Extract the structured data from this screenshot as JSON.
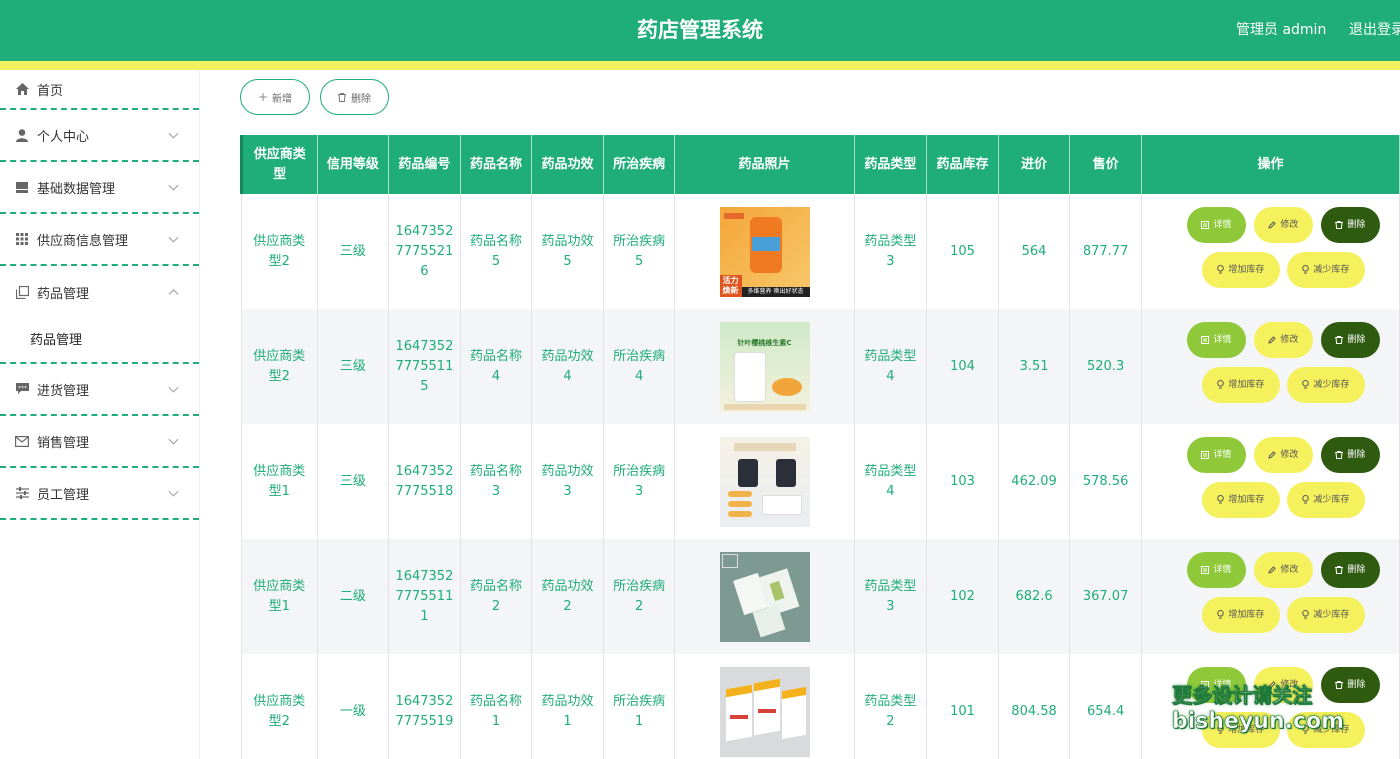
{
  "header": {
    "title": "药店管理系统",
    "admin_label": "管理员 admin",
    "logout_label": "退出登录"
  },
  "sidebar": {
    "items": [
      {
        "label": "首页",
        "icon": "home-icon"
      },
      {
        "label": "个人中心",
        "icon": "user-icon"
      },
      {
        "label": "基础数据管理",
        "icon": "database-icon"
      },
      {
        "label": "供应商信息管理",
        "icon": "grid-icon"
      },
      {
        "label": "药品管理",
        "icon": "copy-icon",
        "expanded": true
      },
      {
        "label": "进货管理",
        "icon": "chat-icon"
      },
      {
        "label": "销售管理",
        "icon": "mail-icon"
      },
      {
        "label": "员工管理",
        "icon": "sliders-icon"
      }
    ],
    "submenu": {
      "label": "药品管理"
    }
  },
  "toolbar": {
    "add_label": "新增",
    "delete_label": "删除"
  },
  "table": {
    "columns": [
      "供应商类型",
      "信用等级",
      "药品编号",
      "药品名称",
      "药品功效",
      "所治疾病",
      "药品照片",
      "药品类型",
      "药品库存",
      "进价",
      "售价",
      "操作"
    ],
    "rows": [
      {
        "supplier_type": "供应商类型2",
        "credit": "三级",
        "code": "16473527775521 6",
        "name": "药品名称5",
        "effect": "药品功效5",
        "disease": "所治疾病5",
        "category": "药品类型3",
        "stock": "105",
        "cost": "564",
        "price": "877.77"
      },
      {
        "supplier_type": "供应商类型2",
        "credit": "三级",
        "code": "16473527775511 5",
        "name": "药品名称4",
        "effect": "药品功效4",
        "disease": "所治疾病4",
        "category": "药品类型4",
        "stock": "104",
        "cost": "3.51",
        "price": "520.3"
      },
      {
        "supplier_type": "供应商类型1",
        "credit": "三级",
        "code": "1647352 7775518",
        "name": "药品名称3",
        "effect": "药品功效3",
        "disease": "所治疾病3",
        "category": "药品类型4",
        "stock": "103",
        "cost": "462.09",
        "price": "578.56"
      },
      {
        "supplier_type": "供应商类型1",
        "credit": "二级",
        "code": "16473527775511 1",
        "name": "药品名称2",
        "effect": "药品功效2",
        "disease": "所治疾病2",
        "category": "药品类型3",
        "stock": "102",
        "cost": "682.6",
        "price": "367.07"
      },
      {
        "supplier_type": "供应商类型2",
        "credit": "一级",
        "code": "1647352 7775519",
        "name": "药品名称1",
        "effect": "药品功效1",
        "disease": "所治疾病1",
        "category": "药品类型2",
        "stock": "101",
        "cost": "804.58",
        "price": "654.4"
      }
    ],
    "actions": {
      "detail": "详情",
      "edit": "修改",
      "delete": "删除",
      "increase": "增加库存",
      "decrease": "减少库存"
    },
    "image_texts": {
      "p1_top": "活力",
      "p1_top2": "焕新",
      "p1_bottom": "多维营养 唤出好状态",
      "p2_title": "针叶樱桃维生素C"
    }
  },
  "watermark": {
    "line1": "更多设计请关注",
    "line2": "bisheyun.com"
  },
  "colors": {
    "primary": "#1fad79",
    "accent_yellow": "#f5f15d",
    "detail_green": "#8fc93a",
    "delete_dark": "#2e5b10"
  }
}
